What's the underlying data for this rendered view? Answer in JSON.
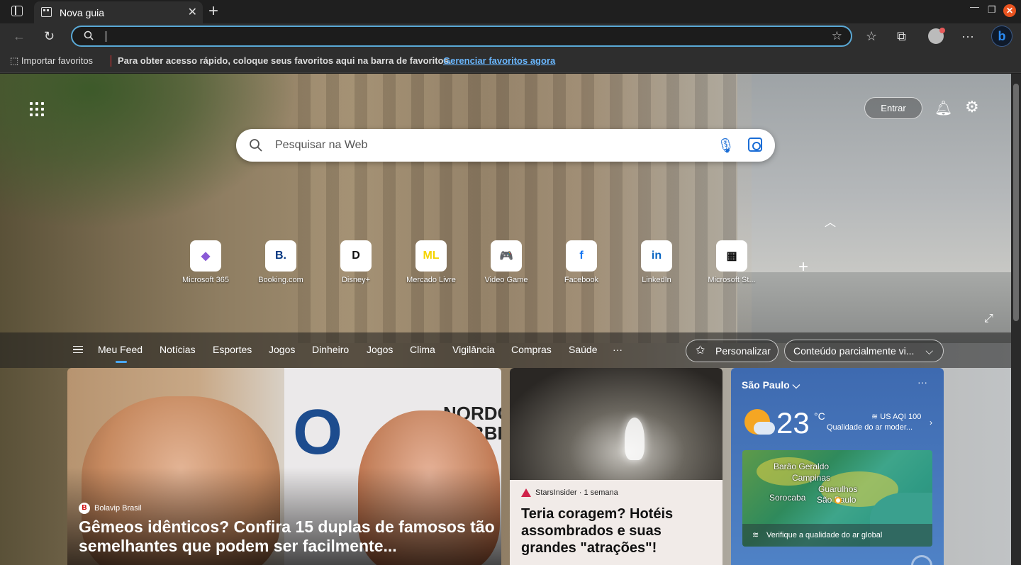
{
  "browser": {
    "tab_title": "Nova guia",
    "address_value": ""
  },
  "favorites_bar": {
    "import_label": "Importar favoritos",
    "message": "Para obter acesso rápido, coloque seus favoritos aqui na barra de favoritos.",
    "manage_link": "Gerenciar favoritos agora"
  },
  "header": {
    "signin_label": "Entrar"
  },
  "search": {
    "placeholder": "Pesquisar na Web"
  },
  "quick_links": [
    {
      "label": "Microsoft 365",
      "glyph": "◆",
      "color": "#8a5ad6"
    },
    {
      "label": "Booking.com",
      "glyph": "B.",
      "color": "#003580"
    },
    {
      "label": "Disney+",
      "glyph": "D",
      "color": "#111111"
    },
    {
      "label": "Mercado Livre",
      "glyph": "ML",
      "color": "#f5d400"
    },
    {
      "label": "Video Game",
      "glyph": "🎮",
      "color": "#4a2fa6"
    },
    {
      "label": "Facebook",
      "glyph": "f",
      "color": "#1877f2"
    },
    {
      "label": "LinkedIn",
      "glyph": "in",
      "color": "#0a66c2"
    },
    {
      "label": "Microsoft St...",
      "glyph": "▦",
      "color": "#111111"
    }
  ],
  "feed_tabs": [
    "Meu Feed",
    "Notícias",
    "Esportes",
    "Jogos",
    "Dinheiro",
    "Jogos",
    "Clima",
    "Vigilância",
    "Compras",
    "Saúde",
    "···"
  ],
  "feed_controls": {
    "personalize_label": "Personalizar",
    "layout_label": "Conteúdo parcialmente vi..."
  },
  "cards": {
    "main": {
      "source": "Bolavip Brasil",
      "headline": "Gêmeos idênticos? Confira 15 duplas de famosos tão semelhantes que podem ser facilmente...",
      "image_text_1": "O",
      "image_text_2": "NORDO\nROBBIN"
    },
    "secondary": {
      "source": "StarsInsider · 1 semana",
      "headline": "Teria coragem? Hotéis assombrados e suas grandes \"atrações\"!"
    }
  },
  "weather": {
    "city": "São Paulo",
    "temperature": "23",
    "unit": "°C",
    "aqi": "US AQI 100",
    "air_quality": "Qualidade do ar moder...",
    "map_labels": [
      "Barão Geraldo",
      "Campinas",
      "Guarulhos",
      "Sorocaba",
      "São Paulo"
    ],
    "map_footer": "Verifique a qualidade do ar global"
  },
  "colors": {
    "accent": "#4aa8ff",
    "address_border": "#5aa9d6",
    "close_window": "#e95420"
  }
}
